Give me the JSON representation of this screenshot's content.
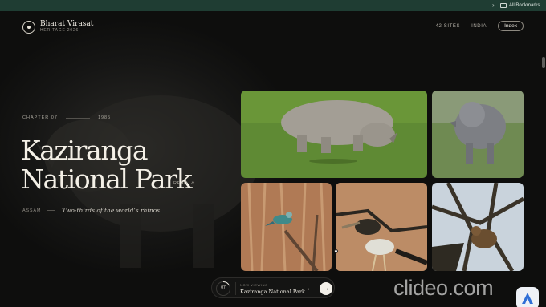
{
  "browser": {
    "more_icon": "chevron-right-icon",
    "more_glyph": "›",
    "bookmarks_label": "All Bookmarks"
  },
  "site": {
    "name": "Bharat Virasat",
    "subtitle": "HERITAGE 2026",
    "nav": [
      "42 SITES",
      "INDIA"
    ],
    "index_label": "Index"
  },
  "hero": {
    "chapter": "CHAPTER 07",
    "year": "1985",
    "title_line1": "Kaziranga",
    "title_line2": "National Park",
    "read_label": "READ",
    "read_arrow": "↗",
    "region": "ASSAM",
    "tagline": "Two-thirds of the world’s rhinos"
  },
  "photos": [
    "rhino-grazing-photo",
    "rhino-standing-photo",
    "roller-bird-photo",
    "stork-photo",
    "eagle-in-tree-photo"
  ],
  "now_viewing": {
    "number": "07",
    "label": "NOW VIEWING",
    "title": "Kaziranga National Park",
    "prev_glyph": "←",
    "next_glyph": "→",
    "progress": 0.17
  },
  "watermark": {
    "text": "clideo.com"
  },
  "colors": {
    "bookmarks_bar": "#1f3d33",
    "background": "#0d0d0c",
    "text": "#f4f0e7"
  }
}
